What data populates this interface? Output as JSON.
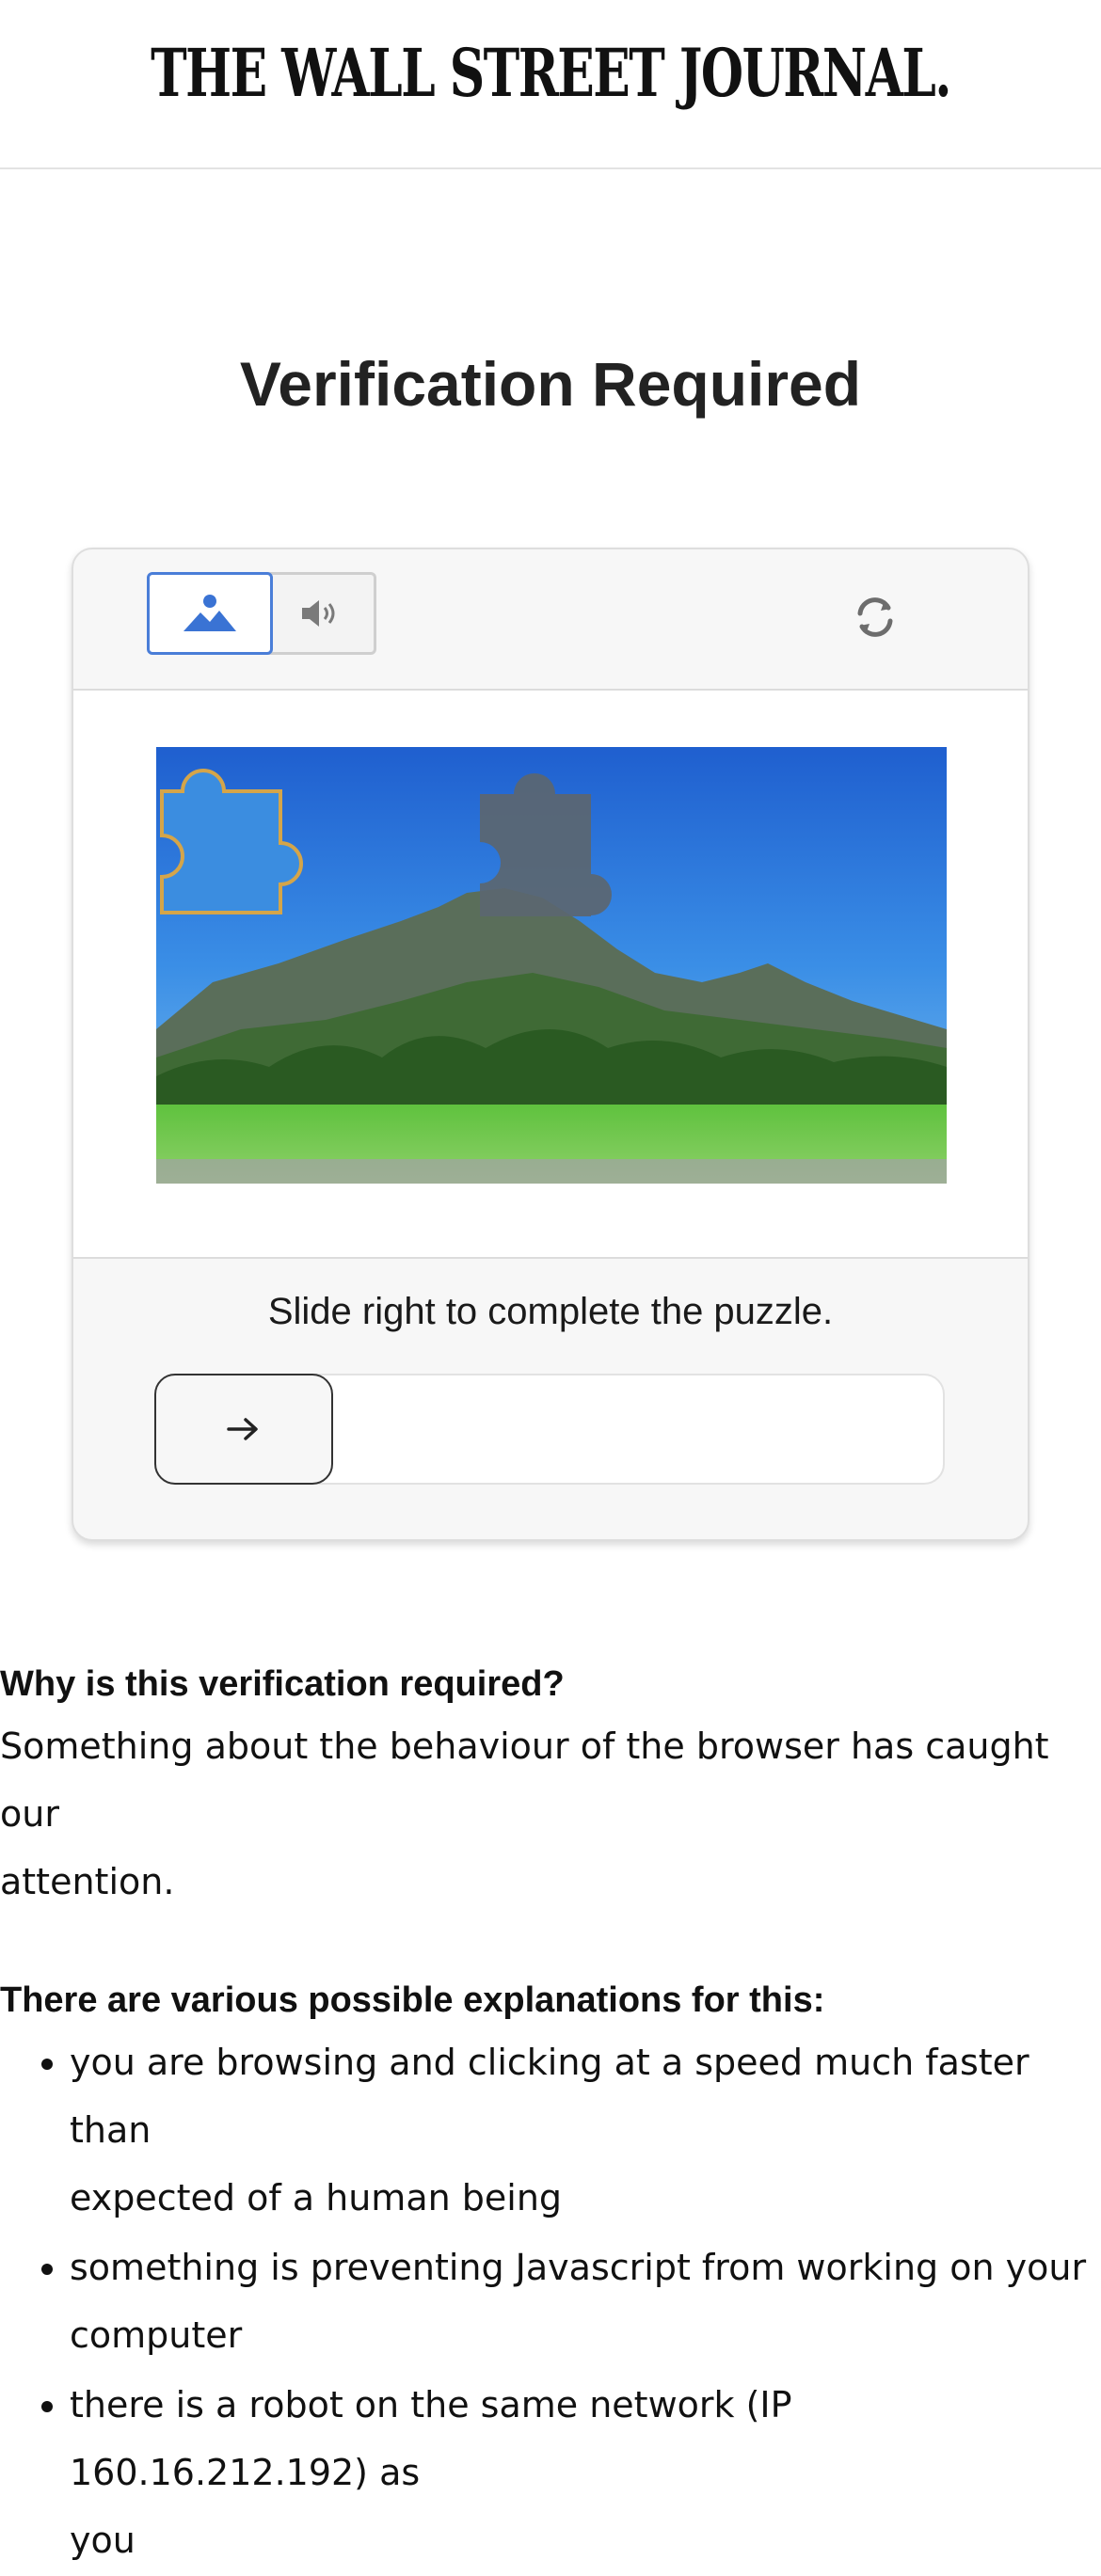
{
  "header": {
    "logo_text": "THE WALL STREET JOURNAL."
  },
  "page": {
    "title": "Verification Required"
  },
  "captcha": {
    "modes": [
      {
        "name": "image-mode",
        "icon": "mountain-icon",
        "selected": true
      },
      {
        "name": "audio-mode",
        "icon": "speaker-icon",
        "selected": false
      }
    ],
    "refresh_icon": "refresh-icon",
    "puzzle_icon": "puzzle-piece-icon",
    "instruction": "Slide right to complete the puzzle.",
    "slider_icon": "arrow-right-icon",
    "slider_progress": 0,
    "colors": {
      "accent": "#4a7ed8",
      "piece_outline": "#d4a54a"
    }
  },
  "info": {
    "why_heading": "Why is this verification required?",
    "why_text_line1": "Something about the behaviour of the browser has caught our",
    "why_text_line2": "attention.",
    "explanations_heading": "There are various possible explanations for this:",
    "items": [
      {
        "line1": "you are browsing and clicking at a speed much faster than",
        "line2": "expected of a human being"
      },
      {
        "line1": "something is preventing Javascript from working on your",
        "line2": "computer"
      },
      {
        "line1": "there is a robot on the same network (IP 160.16.212.192) as",
        "line2": "you"
      }
    ]
  }
}
